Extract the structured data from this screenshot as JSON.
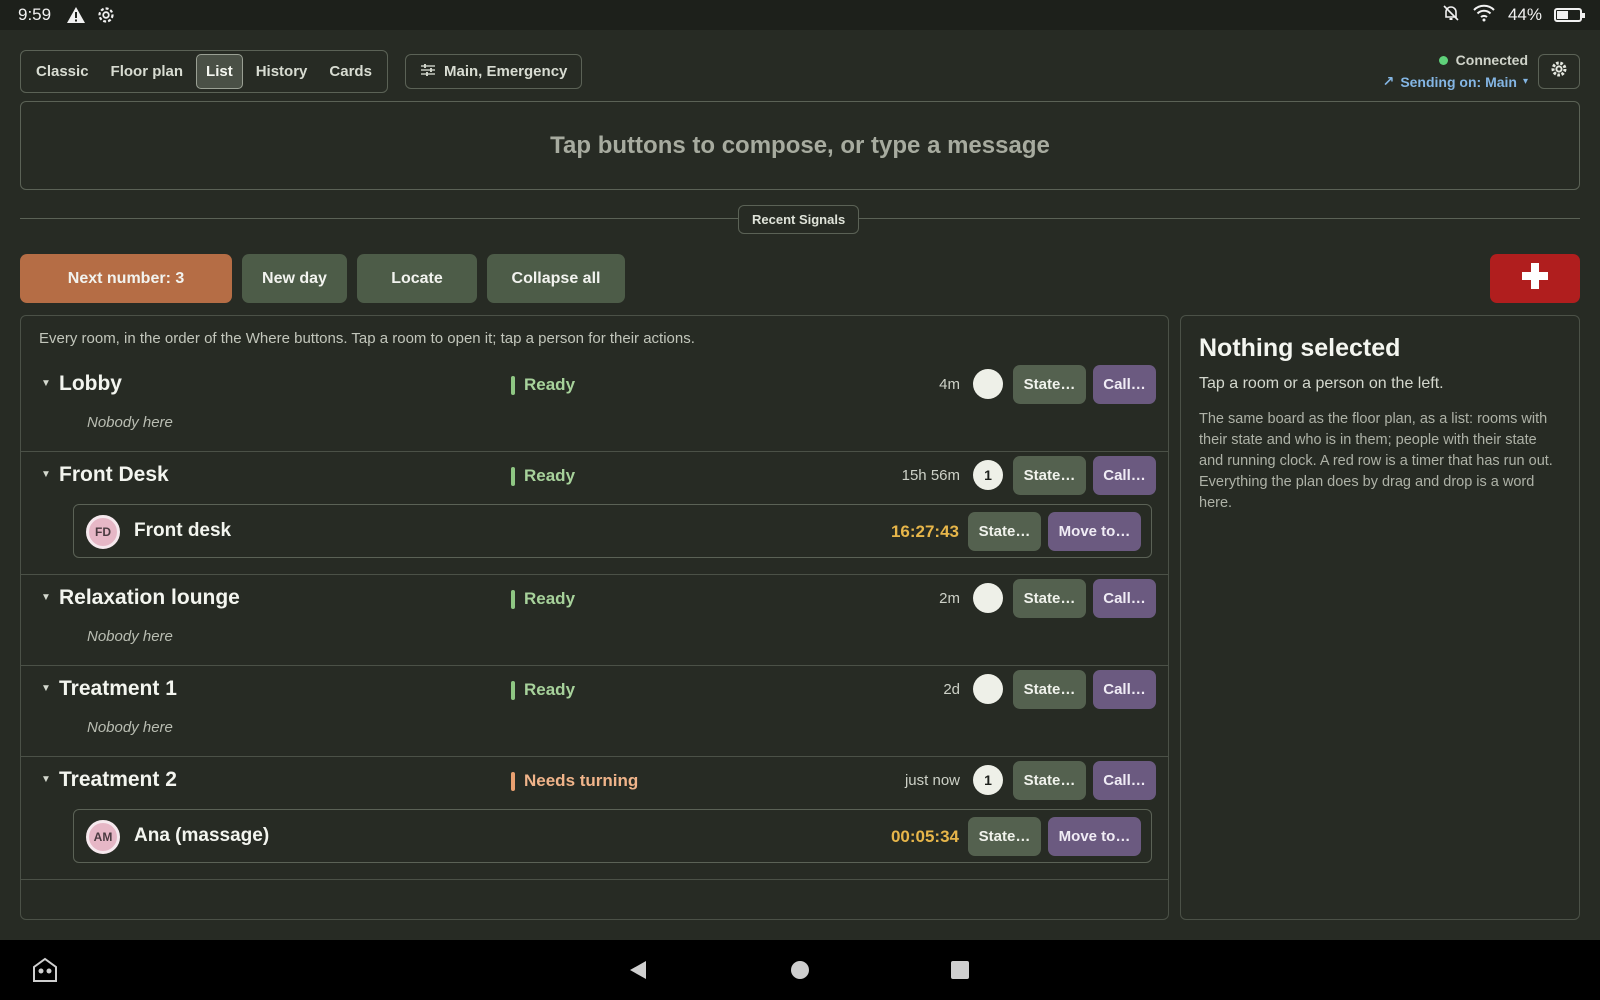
{
  "status_bar": {
    "time": "9:59",
    "battery": "44%",
    "battery_level": 0.44
  },
  "views": {
    "options": [
      "Classic",
      "Floor plan",
      "List",
      "History",
      "Cards"
    ],
    "active": "List"
  },
  "filter": {
    "label": "Main, Emergency"
  },
  "connection": {
    "status": "Connected",
    "sending": "Sending on: Main"
  },
  "compose": {
    "placeholder": "Tap buttons to compose, or type a message"
  },
  "recent_signals": {
    "label": "Recent Signals"
  },
  "actions": {
    "next_number": "Next number: 3",
    "new_day": "New day",
    "locate": "Locate",
    "collapse_all": "Collapse all"
  },
  "list": {
    "hint": "Every room, in the order of the Where buttons. Tap a room to open it; tap a person for their actions.",
    "state_button": "State…",
    "call_button": "Call…",
    "move_button": "Move to…",
    "nobody": "Nobody here",
    "rooms": [
      {
        "name": "Lobby",
        "state": "Ready",
        "age": "4m",
        "count": ""
      },
      {
        "name": "Front Desk",
        "state": "Ready",
        "age": "15h 56m",
        "count": "1",
        "person": {
          "initials": "FD",
          "name": "Front desk",
          "timer": "16:27:43"
        }
      },
      {
        "name": "Relaxation lounge",
        "state": "Ready",
        "age": "2m",
        "count": ""
      },
      {
        "name": "Treatment 1",
        "state": "Ready",
        "age": "2d",
        "count": ""
      },
      {
        "name": "Treatment 2",
        "state": "Needs turning",
        "age": "just now",
        "count": "1",
        "person": {
          "initials": "AM",
          "name": "Ana (massage)",
          "timer": "00:05:34"
        }
      }
    ]
  },
  "detail": {
    "title": "Nothing selected",
    "subtitle": "Tap a room or a person on the left.",
    "body": "The same board as the floor plan, as a list: rooms with their state and who is in them; people with their state and running clock. A red row is a timer that has run out. Everything the plan does by drag and drop is a word here."
  },
  "colors": {
    "background": "#272b24",
    "next_number": "#b56d45",
    "emergency": "#b01e1e",
    "ready": "#a7d29b",
    "needs_turning": "#f0b48a",
    "timer": "#e7b64a"
  }
}
